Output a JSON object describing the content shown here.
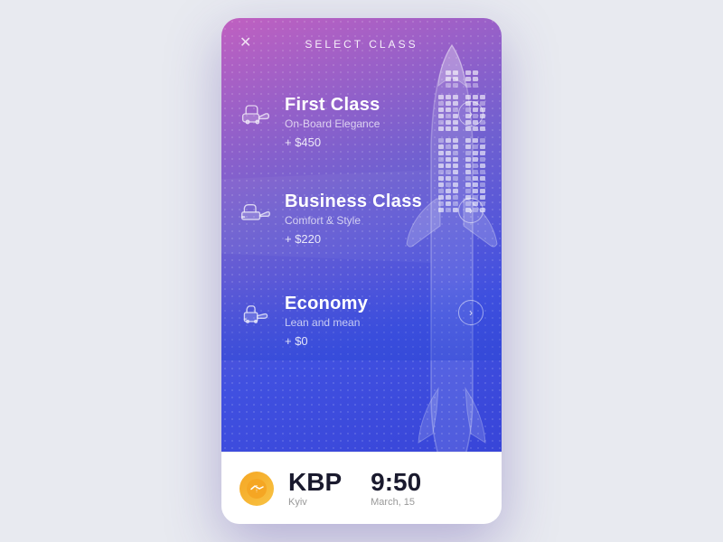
{
  "header": {
    "title": "SELECT CLASS",
    "close_label": "✕"
  },
  "classes": [
    {
      "id": "first",
      "name": "First Class",
      "subtitle": "On-Board Elegance",
      "price": "+ $450",
      "icon": "first-class-seat"
    },
    {
      "id": "business",
      "name": "Business Class",
      "subtitle": "Comfort & Style",
      "price": "+ $220",
      "icon": "business-class-seat"
    },
    {
      "id": "economy",
      "name": "Economy",
      "subtitle": "Lean and mean",
      "price": "+ $0",
      "icon": "economy-seat"
    }
  ],
  "footer": {
    "airline_logo": "✈",
    "airport_code": "KBP",
    "airport_city": "Kyiv",
    "flight_time": "9:50",
    "flight_date": "March, 15"
  }
}
